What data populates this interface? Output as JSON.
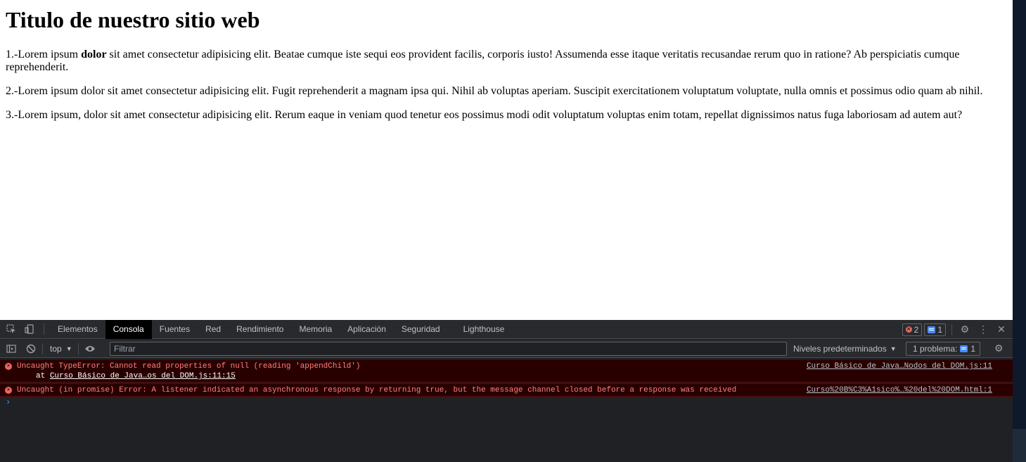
{
  "page": {
    "title": "Titulo de nuestro sitio web",
    "p1_before": "1.-Lorem ipsum ",
    "p1_bold": "dolor",
    "p1_after": " sit amet consectetur adipisicing elit. Beatae cumque iste sequi eos provident facilis, corporis iusto! Assumenda esse itaque veritatis recusandae rerum quo in ratione? Ab perspiciatis cumque reprehenderit.",
    "p2": "2.-Lorem ipsum dolor sit amet consectetur adipisicing elit. Fugit reprehenderit a magnam ipsa qui. Nihil ab voluptas aperiam. Suscipit exercitationem voluptatum voluptate, nulla omnis et possimus odio quam ab nihil.",
    "p3": "3.-Lorem ipsum, dolor sit amet consectetur adipisicing elit. Rerum eaque in veniam quod tenetur eos possimus modi odit voluptatum voluptas enim totam, repellat dignissimos natus fuga laboriosam ad autem aut?"
  },
  "devtools": {
    "tabs": [
      "Elementos",
      "Consola",
      "Fuentes",
      "Red",
      "Rendimiento",
      "Memoria",
      "Aplicación",
      "Seguridad",
      "Lighthouse"
    ],
    "active_tab": "Consola",
    "error_count": "2",
    "message_count": "1",
    "toolbar": {
      "context": "top",
      "filter_placeholder": "Filtrar",
      "levels": "Niveles predeterminados",
      "issues_label": "1 problema:",
      "issues_count": "1"
    },
    "messages": [
      {
        "text": "Uncaught TypeError: Cannot read properties of null (reading 'appendChild')",
        "stack_prefix": "at ",
        "stack_link": "Curso Básico de Java…os del DOM.js:11:15",
        "source": "Curso Básico de Java…Nodos del DOM.js:11"
      },
      {
        "text": "Uncaught (in promise) Error: A listener indicated an asynchronous response by returning true, but the message channel closed before a response was received",
        "source": "Curso%20B%C3%A1sico%…%20del%20DOM.html:1"
      }
    ],
    "prompt_symbol": "›"
  },
  "colors": {
    "devtools_bg": "#202124",
    "error_bg": "#290000",
    "error_text": "#ff8080",
    "accent": "#4c8df6"
  }
}
